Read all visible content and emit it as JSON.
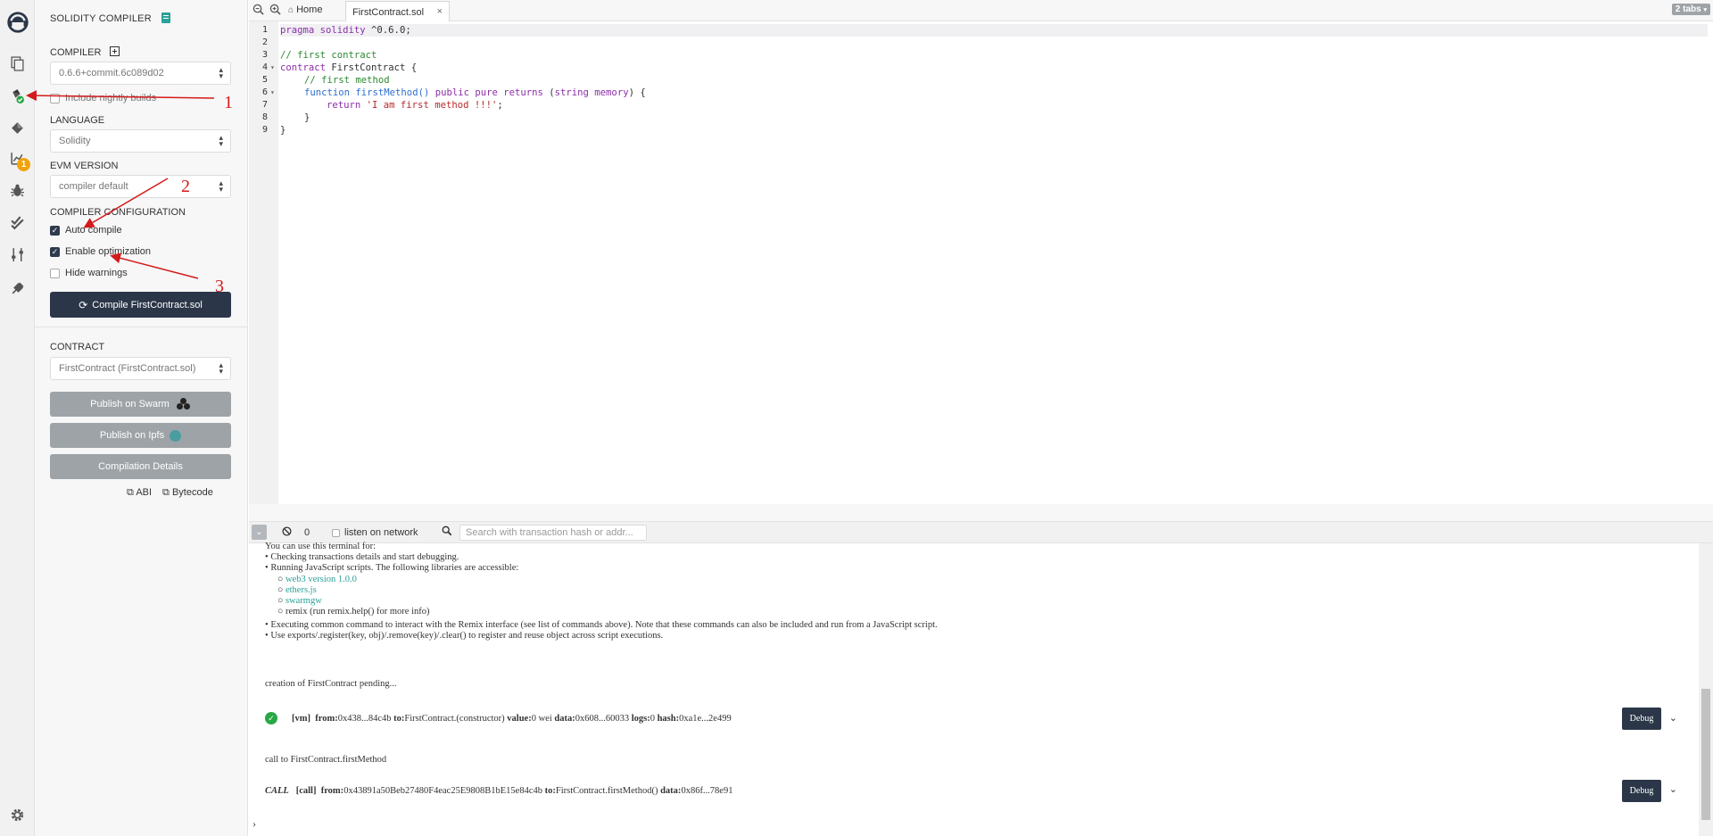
{
  "panel": {
    "title": "SOLIDITY COMPILER",
    "compiler_label": "COMPILER",
    "compiler_value": "0.6.6+commit.6c089d02",
    "nightly_label": "Include nightly builds",
    "language_label": "LANGUAGE",
    "language_value": "Solidity",
    "evm_label": "EVM VERSION",
    "evm_value": "compiler default",
    "config_label": "COMPILER CONFIGURATION",
    "options": [
      {
        "label": "Auto compile",
        "checked": true
      },
      {
        "label": "Enable optimization",
        "checked": true
      },
      {
        "label": "Hide warnings",
        "checked": false
      }
    ],
    "compile_button": "Compile FirstContract.sol",
    "contract_label": "CONTRACT",
    "contract_value": "FirstContract (FirstContract.sol)",
    "publish_swarm": "Publish on Swarm",
    "publish_ipfs": "Publish on Ipfs",
    "compilation_details": "Compilation Details",
    "abi_label": "ABI",
    "bytecode_label": "Bytecode"
  },
  "rail": {
    "badge_count": "1",
    "icons": [
      "remix-logo-icon",
      "file-explorer-icon",
      "solidity-compiler-icon",
      "deploy-run-icon",
      "analysis-icon",
      "debugger-icon",
      "testing-icon",
      "settings-sliders-icon",
      "plugin-icon",
      "settings-gear-icon"
    ]
  },
  "tabs": {
    "home": "Home",
    "file": "FirstContract.sol",
    "count": "2 tabs"
  },
  "editor": {
    "line_numbers": [
      "1",
      "2",
      "3",
      "4",
      "5",
      "6",
      "7",
      "8",
      "9"
    ],
    "line1": {
      "kw": "pragma solidity",
      "rest": " ^0.6.0;"
    },
    "line3": "// first contract",
    "line4": {
      "kw": "contract",
      "rest": " FirstContract {"
    },
    "line5": "// first method",
    "line6": {
      "kw": "function",
      "name": " firstMethod()",
      "kw2": " public pure returns",
      "rest": " (",
      "type": "string memory",
      "end": ") {"
    },
    "line7": {
      "kw": "return",
      "str": " 'I am first method !!!'",
      "end": ";"
    },
    "line8": "}",
    "line9": "}"
  },
  "terminal": {
    "pending_count": "0",
    "listen_label": "listen on network",
    "search_placeholder": "Search with transaction hash or addr...",
    "intro": "You can use this terminal for:",
    "bullet1": "Checking transactions details and start debugging.",
    "bullet2": "Running JavaScript scripts. The following libraries are accessible:",
    "libs": [
      "web3 version 1.0.0",
      "ethers.js",
      "swarmgw"
    ],
    "lib_remix": "remix (run remix.help() for more info)",
    "bullet3": "Executing common command to interact with the Remix interface (see list of commands above). Note that these commands can also be included and run from a JavaScript script.",
    "bullet4": "Use exports/.register(key, obj)/.remove(key)/.clear() to register and reuse object across script executions.",
    "pending_msg": "creation of FirstContract pending...",
    "tx1": {
      "tag": "[vm]",
      "from_label": "from:",
      "from": "0x438...84c4b",
      "to_label": "to:",
      "to": "FirstContract.(constructor)",
      "value_label": "value:",
      "value": "0 wei",
      "data_label": "data:",
      "data": "0x608...60033",
      "logs_label": "logs:",
      "logs": "0",
      "hash_label": "hash:",
      "hash": "0xa1e...2e499"
    },
    "call_msg": "call to FirstContract.firstMethod",
    "tx2": {
      "call": "CALL",
      "tag": "[call]",
      "from_label": "from:",
      "from": "0x43891a50Beb27480F4eac25E9808B1bE15e84c4b",
      "to_label": "to:",
      "to": "FirstContract.firstMethod()",
      "data_label": "data:",
      "data": "0x86f...78e91"
    },
    "debug_label": "Debug",
    "prompt": "›"
  },
  "annotations": [
    "1",
    "2",
    "3"
  ],
  "colors": {
    "accent_dark": "#2b3748",
    "success_green": "#28a745",
    "annotation_red": "#d41a1a",
    "badge_orange": "#f0a30a"
  }
}
